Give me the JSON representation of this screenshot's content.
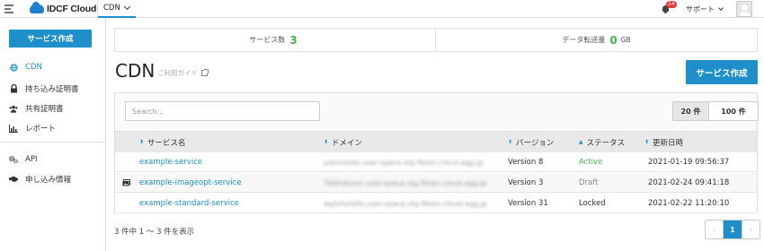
{
  "app": {
    "logo_text": "IDCF Cloud",
    "product_tab": "CDN"
  },
  "topbar": {
    "notification_count": "24",
    "support_label": "サポート"
  },
  "sidebar": {
    "create_button": "サービス作成",
    "items": [
      {
        "label": "CDN",
        "icon": "globe-icon",
        "active": true
      },
      {
        "label": "持ち込み証明書",
        "icon": "lock-icon"
      },
      {
        "label": "共有証明書",
        "icon": "users-icon"
      },
      {
        "label": "レポート",
        "icon": "bar-chart-icon"
      },
      {
        "label": "API",
        "icon": "gears-icon"
      },
      {
        "label": "申し込み情報",
        "icon": "handshake-icon"
      }
    ]
  },
  "stats": {
    "service_count_label": "サービス数",
    "service_count": "3",
    "transfer_label": "データ転送量",
    "transfer_value": "0",
    "transfer_unit": "GB"
  },
  "main": {
    "title": "CDN",
    "guide_link": "ご利用ガイド",
    "create_button": "サービス作成",
    "search_placeholder": "Search...",
    "page_size_20": "20 件",
    "page_size_100": "100 件"
  },
  "table": {
    "headers": {
      "name": "サービス名",
      "domain": "ドメイン",
      "version": "バージョン",
      "status": "ステータス",
      "updated": "更新日時"
    },
    "rows": [
      {
        "name": "example-service",
        "domain": "yqmxxzdz.user-space.stg.fleixn.cloud.egg.jp",
        "version": "Version 8",
        "status": "Active",
        "updated": "2021-01-19 09:56:37",
        "icon": ""
      },
      {
        "name": "example-imageopt-service",
        "domain": "7bbhdzuxn.user-space.stg.fleixn.cloud.egg.jp",
        "version": "Version 3",
        "status": "Draft",
        "updated": "2021-02-24 09:41:18",
        "icon": "image-icon"
      },
      {
        "name": "example-standard-service",
        "domain": "aq3vfuhkfe.user-space.stg.fleixn.cloud.egg.jp",
        "version": "Version 31",
        "status": "Locked",
        "updated": "2021-02-22 11:20:10",
        "icon": ""
      }
    ]
  },
  "footer": {
    "summary": "3 件中 1 〜 3 件を表示",
    "current_page": "1",
    "prev_symbol": "‹",
    "next_symbol": "›"
  },
  "colors": {
    "accent": "#1e8fc9",
    "active_status": "#4caf50",
    "badge": "#e53935"
  }
}
